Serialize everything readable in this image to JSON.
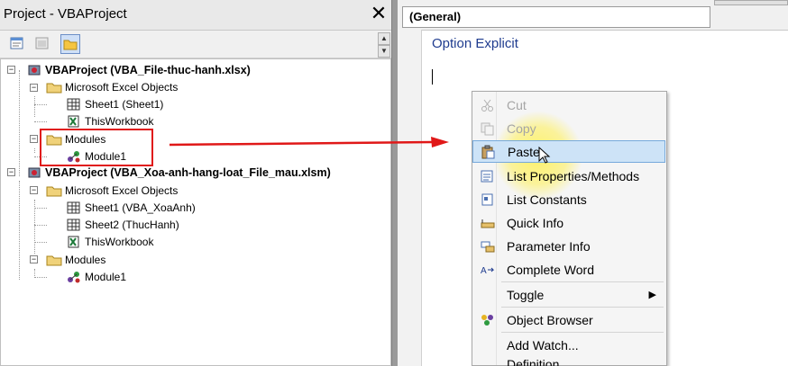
{
  "project_explorer": {
    "title": "Project - VBAProject",
    "close_label": "✕",
    "toolbar": [
      "view-code",
      "view-object",
      "toggle-folders"
    ],
    "tree": [
      {
        "label": "VBAProject (VBA_File-thuc-hanh.xlsx)"
      },
      {
        "label": "Microsoft Excel Objects"
      },
      {
        "label": "Sheet1 (Sheet1)"
      },
      {
        "label": "ThisWorkbook"
      },
      {
        "label": "Modules"
      },
      {
        "label": "Module1"
      },
      {
        "label": "VBAProject (VBA_Xoa-anh-hang-loat_File_mau.xlsm)"
      },
      {
        "label": "Microsoft Excel Objects"
      },
      {
        "label": "Sheet1 (VBA_XoaAnh)"
      },
      {
        "label": "Sheet2 (ThucHanh)"
      },
      {
        "label": "ThisWorkbook"
      },
      {
        "label": "Modules"
      },
      {
        "label": "Module1"
      }
    ]
  },
  "code_window": {
    "object_dropdown": "(General)",
    "code_line": "Option Explicit"
  },
  "context_menu": {
    "items": [
      {
        "label": "Cut",
        "enabled": false,
        "icon": "scissors-icon"
      },
      {
        "label": "Copy",
        "enabled": false,
        "icon": "copy-icon"
      },
      {
        "label": "Paste",
        "enabled": true,
        "highlighted": true,
        "icon": "paste-icon"
      },
      {
        "label": "List Properties/Methods",
        "enabled": true,
        "icon": "list-properties-icon"
      },
      {
        "label": "List Constants",
        "enabled": true,
        "icon": "list-constants-icon"
      },
      {
        "label": "Quick Info",
        "enabled": true,
        "icon": "quick-info-icon"
      },
      {
        "label": "Parameter Info",
        "enabled": true,
        "icon": "parameter-info-icon"
      },
      {
        "label": "Complete Word",
        "enabled": true,
        "icon": "complete-word-icon"
      },
      {
        "label": "Toggle",
        "enabled": true,
        "submenu": true
      },
      {
        "label": "Object Browser",
        "enabled": true,
        "icon": "object-browser-icon"
      },
      {
        "label": "Add Watch...",
        "enabled": true
      },
      {
        "label": "Definition",
        "enabled": true
      }
    ]
  },
  "annotation": {
    "color": "#e01818"
  },
  "colors": {
    "code_keyword": "#1f3c8f",
    "menu_highlight": "#cde3f7",
    "disabled_text": "#a5a5a5"
  }
}
